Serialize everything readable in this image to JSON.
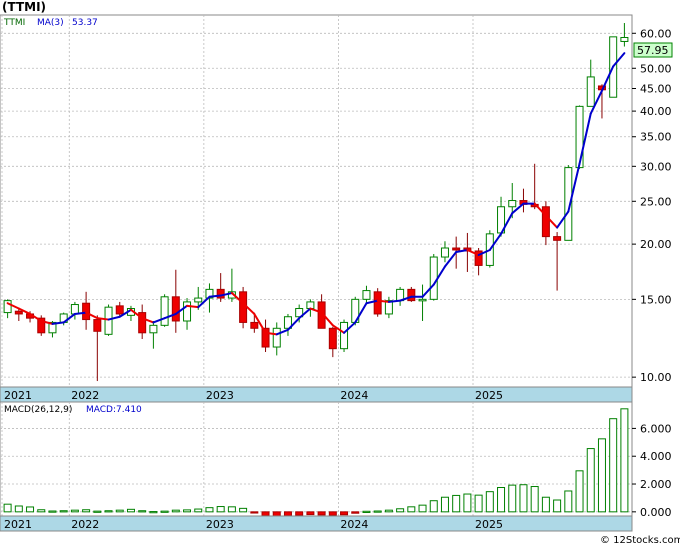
{
  "title": "(TTMI)",
  "watermark": "© 12Stocks.com",
  "colors": {
    "up_body": "#ffffff",
    "down_body": "#ee0000",
    "up_outline": "#008000",
    "ma_up": "#0000cc",
    "ma_down": "#ee0000",
    "axis_band": "#add8e6",
    "grid": "#bbbbbb",
    "macd_bar": "#008000"
  },
  "chart_data": [
    {
      "type": "candlestick",
      "scale": "log",
      "legend": {
        "ticker": "TTMI",
        "ma_label": "MA(3)",
        "ma_value": "53.37"
      },
      "last_price_label": "57.95",
      "y_ticks": [
        "10.00",
        "15.00",
        "20.00",
        "25.00",
        "30.00",
        "35.00",
        "40.00",
        "45.00",
        "50.00",
        "60.00"
      ],
      "ylim": [
        9.5,
        66
      ],
      "x_tick_labels": [
        {
          "label": "2021",
          "index": 0
        },
        {
          "label": "2022",
          "index": 6
        },
        {
          "label": "2023",
          "index": 18
        },
        {
          "label": "2024",
          "index": 30
        },
        {
          "label": "2025",
          "index": 42
        }
      ],
      "candles": [
        [
          14.0,
          15.0,
          13.6,
          14.9
        ],
        [
          14.1,
          14.3,
          13.4,
          13.9
        ],
        [
          13.9,
          14.1,
          13.3,
          13.6
        ],
        [
          13.6,
          13.8,
          12.4,
          12.6
        ],
        [
          12.6,
          13.4,
          12.3,
          13.3
        ],
        [
          13.3,
          14.0,
          13.1,
          13.9
        ],
        [
          13.9,
          14.8,
          13.5,
          14.6
        ],
        [
          14.7,
          15.6,
          12.8,
          13.5
        ],
        [
          13.5,
          13.8,
          9.8,
          12.7
        ],
        [
          12.5,
          14.6,
          12.4,
          14.4
        ],
        [
          14.5,
          14.8,
          13.7,
          13.9
        ],
        [
          13.8,
          14.5,
          13.4,
          14.3
        ],
        [
          14.0,
          14.6,
          12.2,
          12.6
        ],
        [
          12.6,
          13.4,
          11.6,
          13.1
        ],
        [
          13.1,
          15.4,
          13.0,
          15.2
        ],
        [
          15.2,
          17.5,
          12.6,
          13.4
        ],
        [
          13.4,
          15.1,
          12.8,
          14.8
        ],
        [
          14.8,
          16.0,
          14.2,
          15.1
        ],
        [
          15.1,
          16.3,
          14.0,
          15.8
        ],
        [
          15.8,
          17.2,
          14.8,
          15.1
        ],
        [
          15.1,
          17.6,
          14.8,
          15.6
        ],
        [
          15.6,
          16.0,
          12.9,
          13.3
        ],
        [
          13.3,
          14.0,
          12.6,
          12.9
        ],
        [
          12.9,
          13.5,
          11.4,
          11.7
        ],
        [
          11.7,
          13.3,
          11.2,
          12.9
        ],
        [
          12.9,
          13.9,
          12.4,
          13.7
        ],
        [
          13.7,
          14.6,
          13.3,
          14.3
        ],
        [
          14.3,
          15.0,
          13.7,
          14.8
        ],
        [
          14.8,
          15.4,
          12.9,
          12.9
        ],
        [
          12.9,
          13.0,
          11.1,
          11.6
        ],
        [
          11.6,
          13.5,
          11.4,
          13.3
        ],
        [
          13.3,
          15.2,
          13.1,
          15.0
        ],
        [
          15.0,
          16.1,
          14.7,
          15.7
        ],
        [
          15.6,
          15.9,
          13.7,
          13.9
        ],
        [
          13.9,
          15.2,
          13.6,
          14.9
        ],
        [
          14.9,
          16.0,
          14.5,
          15.8
        ],
        [
          15.8,
          16.0,
          14.8,
          14.9
        ],
        [
          14.9,
          16.2,
          13.4,
          15.0
        ],
        [
          15.0,
          19.0,
          14.9,
          18.7
        ],
        [
          18.7,
          20.3,
          18.2,
          19.6
        ],
        [
          19.6,
          20.8,
          17.6,
          19.4
        ],
        [
          19.6,
          21.2,
          17.3,
          19.3
        ],
        [
          19.3,
          19.6,
          17.0,
          17.9
        ],
        [
          17.9,
          21.5,
          17.7,
          21.1
        ],
        [
          21.2,
          25.6,
          20.8,
          24.3
        ],
        [
          24.3,
          27.5,
          22.9,
          25.1
        ],
        [
          25.1,
          26.7,
          23.6,
          24.6
        ],
        [
          24.6,
          30.4,
          24.0,
          24.3
        ],
        [
          24.3,
          25.0,
          19.9,
          20.8
        ],
        [
          20.8,
          21.3,
          15.7,
          20.4
        ],
        [
          20.4,
          30.2,
          22.0,
          29.8
        ],
        [
          29.8,
          41.2,
          29.6,
          41.0
        ],
        [
          41.0,
          52.3,
          41.0,
          47.8
        ],
        [
          45.6,
          46.0,
          38.5,
          44.7
        ],
        [
          43.0,
          59.0,
          43.0,
          58.9
        ],
        [
          57.5,
          63.3,
          56.0,
          58.7
        ]
      ],
      "ma3": [
        14.7,
        14.3,
        13.9,
        13.4,
        13.2,
        13.3,
        13.9,
        14.0,
        13.6,
        13.5,
        13.7,
        14.2,
        13.6,
        13.3,
        13.6,
        13.9,
        14.5,
        14.4,
        15.2,
        15.3,
        15.5,
        14.7,
        13.9,
        12.6,
        12.5,
        12.8,
        13.6,
        14.3,
        14.0,
        13.1,
        12.6,
        13.3,
        14.7,
        14.9,
        14.8,
        14.9,
        15.2,
        15.2,
        16.2,
        17.8,
        19.2,
        19.4,
        18.9,
        19.4,
        21.1,
        23.5,
        24.7,
        24.7,
        23.2,
        21.8,
        23.7,
        30.4,
        39.5,
        44.5,
        50.5,
        54.1
      ]
    },
    {
      "type": "bar",
      "title": "MACD(26,12,9)",
      "macd_label": "MACD:7.410",
      "y_ticks": [
        "0.000",
        "2.000",
        "4.000",
        "6.000"
      ],
      "ylim": [
        -0.3,
        7.9
      ],
      "x_tick_labels": [
        "2021",
        "2022",
        "2023",
        "2024",
        "2025"
      ],
      "values": [
        0.55,
        0.42,
        0.35,
        0.15,
        0.06,
        0.08,
        0.12,
        0.15,
        0.05,
        0.08,
        0.12,
        0.18,
        0.08,
        0.02,
        0.05,
        0.12,
        0.14,
        0.2,
        0.3,
        0.38,
        0.36,
        0.25,
        -0.06,
        -0.28,
        -0.3,
        -0.28,
        -0.24,
        -0.2,
        -0.22,
        -0.25,
        -0.21,
        -0.1,
        0.04,
        0.06,
        0.12,
        0.22,
        0.36,
        0.48,
        0.8,
        1.05,
        1.18,
        1.28,
        1.2,
        1.45,
        1.75,
        1.92,
        1.95,
        1.82,
        1.05,
        0.85,
        1.5,
        2.95,
        4.55,
        5.25,
        6.7,
        7.41
      ]
    }
  ]
}
